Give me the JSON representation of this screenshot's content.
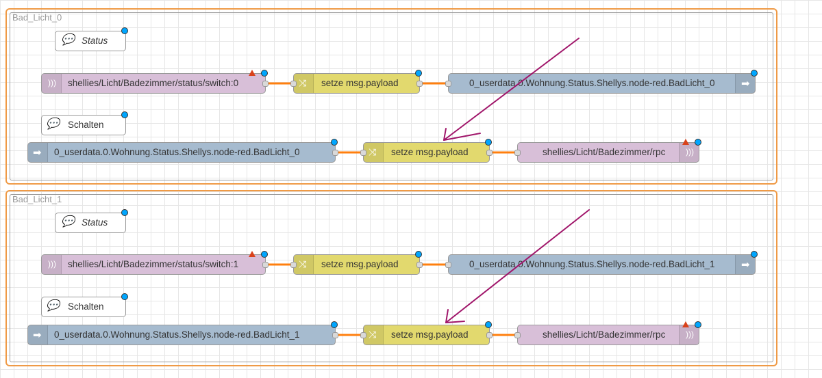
{
  "groups": [
    {
      "name": "Bad_Licht_0",
      "status_comment": "Status",
      "switch_comment": "Schalten",
      "mqtt_in": "shellies/Licht/Badezimmer/status/switch:0",
      "change1": "setze msg.payload",
      "iob_out": "0_userdata.0.Wohnung.Status.Shellys.node-red.BadLicht_0",
      "iob_in": "0_userdata.0.Wohnung.Status.Shellys.node-red.BadLicht_0",
      "change2": "setze msg.payload",
      "mqtt_out": "shellies/Licht/Badezimmer/rpc"
    },
    {
      "name": "Bad_Licht_1",
      "status_comment": "Status",
      "switch_comment": "Schalten",
      "mqtt_in": "shellies/Licht/Badezimmer/status/switch:1",
      "change1": "setze msg.payload",
      "iob_out": "0_userdata.0.Wohnung.Status.Shellys.node-red.BadLicht_1",
      "iob_in": "0_userdata.0.Wohnung.Status.Shellys.node-red.BadLicht_1",
      "change2": "setze msg.payload",
      "mqtt_out": "shellies/Licht/Badezimmer/rpc"
    }
  ],
  "colors": {
    "wire": "#ff7f0e",
    "group_border": "#ef9a46",
    "annotation": "#a0156a",
    "mqtt": "#d8bfd8",
    "change": "#e2d96e",
    "iobroker": "#a6bbcf"
  }
}
